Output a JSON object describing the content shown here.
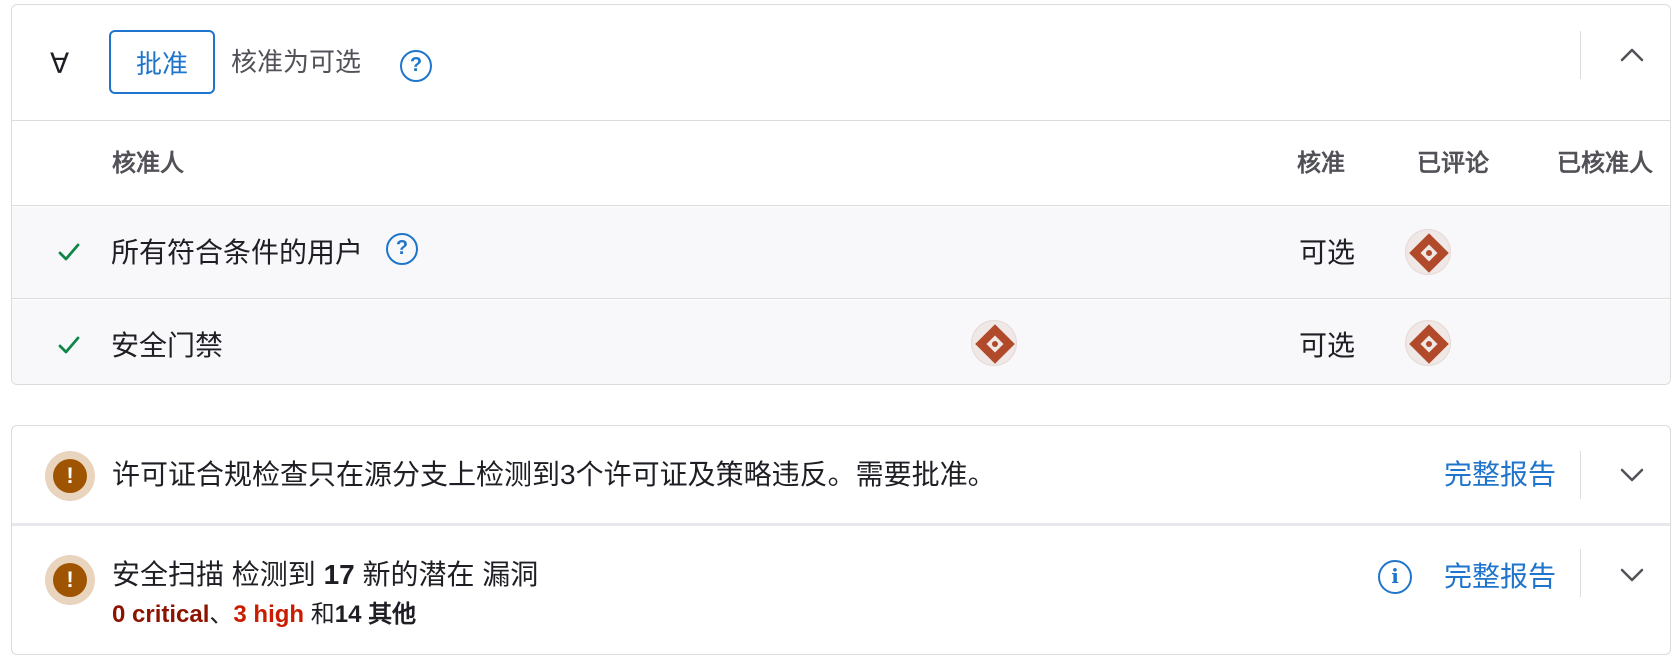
{
  "approval": {
    "icon": "approval-icon",
    "approve_label": "批准",
    "status_text": "核准为可选",
    "columns": {
      "approvers": "核准人",
      "approval": "核准",
      "commented": "已评论",
      "approved_by": "已核准人"
    },
    "rules": [
      {
        "name": "所有符合条件的用户",
        "requirement": "可选",
        "approved": true
      },
      {
        "name": "安全门禁",
        "requirement": "可选",
        "approved": true
      }
    ]
  },
  "license_widget": {
    "text": "许可证合规检查只在源分支上检测到3个许可证及策略违反。需要批准。",
    "report_label": "完整报告",
    "status": "warning"
  },
  "security_widget": {
    "title_prefix": "安全扫描 检测到 ",
    "count": "17",
    "title_suffix": " 新的潜在 漏洞",
    "critical": "0 critical",
    "sep1": "、",
    "high": "3 high",
    "sep2": " 和",
    "others": "14 其他",
    "report_label": "完整报告",
    "status": "warning"
  },
  "colors": {
    "link": "#1f75cb",
    "success": "#108548",
    "warning": "#9e5400",
    "critical": "#8d1300",
    "high": "#c91c00"
  }
}
